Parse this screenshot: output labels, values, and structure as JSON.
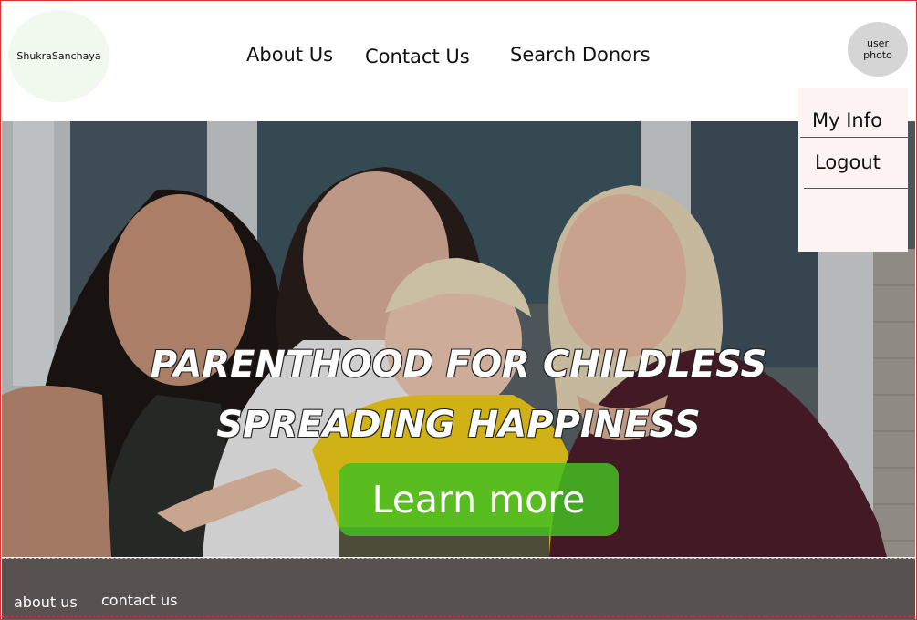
{
  "brand": {
    "name": "ShukraSanchaya"
  },
  "nav": {
    "about": "About Us",
    "contact": "Contact Us",
    "search": "Search Donors"
  },
  "user": {
    "avatar_line1": "user",
    "avatar_line2": "photo"
  },
  "dropdown": {
    "items": [
      {
        "label": "My Info"
      },
      {
        "label": "Logout"
      }
    ]
  },
  "hero": {
    "headline1": "PARENTHOOD FOR CHILDLESS",
    "headline2": "SPREADING HAPPINESS",
    "cta": "Learn more",
    "image": "family-photo",
    "cta_color": "#44be22"
  },
  "footer": {
    "about": "about us",
    "contact": "contact us",
    "bg_color": "#57514f"
  }
}
